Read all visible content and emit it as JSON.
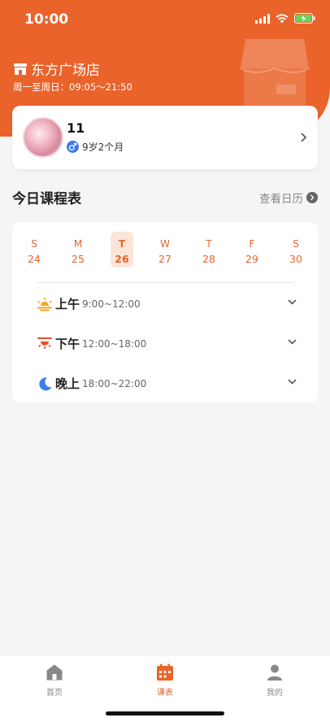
{
  "status_bar": {
    "time": "10:00"
  },
  "store": {
    "name": "东方广场店",
    "hours": "周一至周日：09:05～21:50"
  },
  "student": {
    "name": "11",
    "age": "9岁2个月"
  },
  "schedule": {
    "title": "今日课程表",
    "calendar_link": "查看日历",
    "days": [
      {
        "dow": "S",
        "date": "24"
      },
      {
        "dow": "M",
        "date": "25"
      },
      {
        "dow": "T",
        "date": "26",
        "active": true
      },
      {
        "dow": "W",
        "date": "27"
      },
      {
        "dow": "T",
        "date": "28"
      },
      {
        "dow": "F",
        "date": "29"
      },
      {
        "dow": "S",
        "date": "30"
      }
    ],
    "periods": [
      {
        "name": "上午",
        "time": "9:00~12:00",
        "icon": "sunrise-icon"
      },
      {
        "name": "下午",
        "time": "12:00~18:00",
        "icon": "sunset-icon"
      },
      {
        "name": "晚上",
        "time": "18:00~22:00",
        "icon": "moon-icon"
      }
    ]
  },
  "tabs": [
    {
      "label": "首页",
      "icon": "home-icon"
    },
    {
      "label": "课表",
      "icon": "calendar-icon",
      "active": true
    },
    {
      "label": "我的",
      "icon": "user-icon"
    }
  ],
  "colors": {
    "accent": "#e9632b",
    "active_day_bg": "#fbe5d9",
    "male_badge": "#3d7be6",
    "moon": "#3f7de8"
  }
}
